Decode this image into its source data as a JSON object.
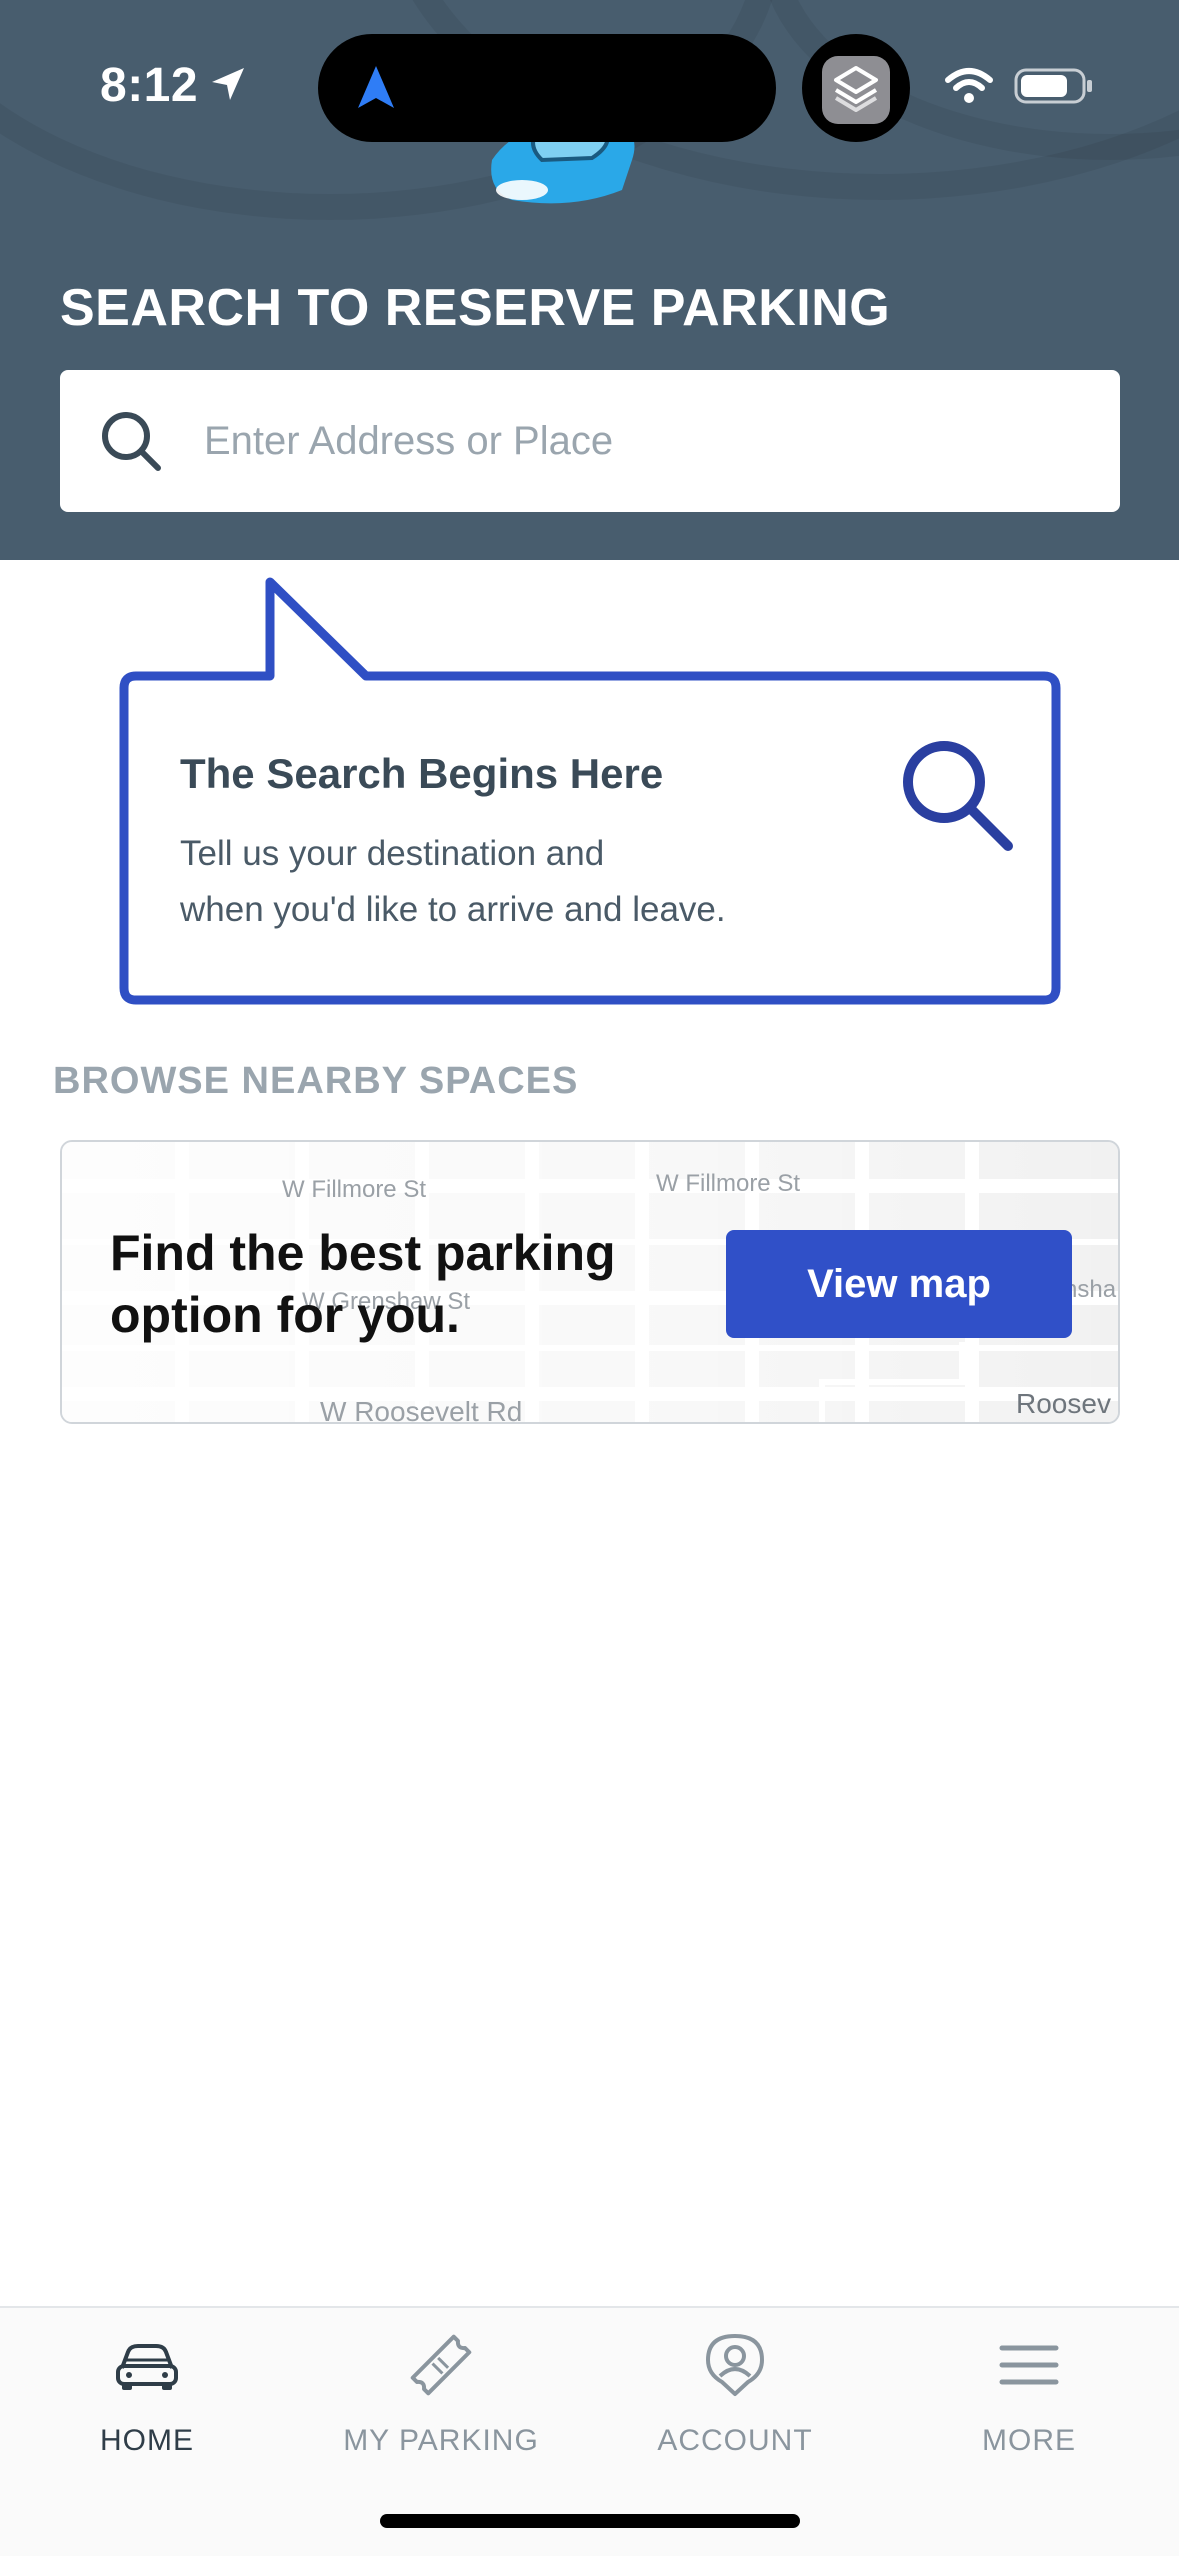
{
  "status_bar": {
    "time": "8:12"
  },
  "header": {
    "title": "SEARCH TO RESERVE PARKING"
  },
  "search": {
    "placeholder": "Enter Address or Place",
    "value": ""
  },
  "callout": {
    "title": "The Search Begins Here",
    "body_lines": [
      "Tell us your destination and",
      "when you'd like to arrive and leave."
    ]
  },
  "browse": {
    "heading": "BROWSE NEARBY SPACES",
    "card": {
      "headline_lines": [
        "Find the best parking",
        "option for you."
      ],
      "button_label": "View map",
      "streets": [
        "W Fillmore St",
        "W Fillmore St",
        "W Grenshaw St",
        "W Roosevelt Rd",
        "Roosev",
        "nsha"
      ]
    }
  },
  "tabs": [
    {
      "label": "HOME",
      "icon": "car-icon",
      "active": true
    },
    {
      "label": "MY PARKING",
      "icon": "ticket-icon",
      "active": false
    },
    {
      "label": "ACCOUNT",
      "icon": "user-pin-icon",
      "active": false
    },
    {
      "label": "MORE",
      "icon": "menu-icon",
      "active": false
    }
  ],
  "colors": {
    "header_bg": "#485d6e",
    "accent_blue": "#3050c8",
    "callout_border": "#2f4fc4",
    "muted_text": "#9aa5ae"
  }
}
